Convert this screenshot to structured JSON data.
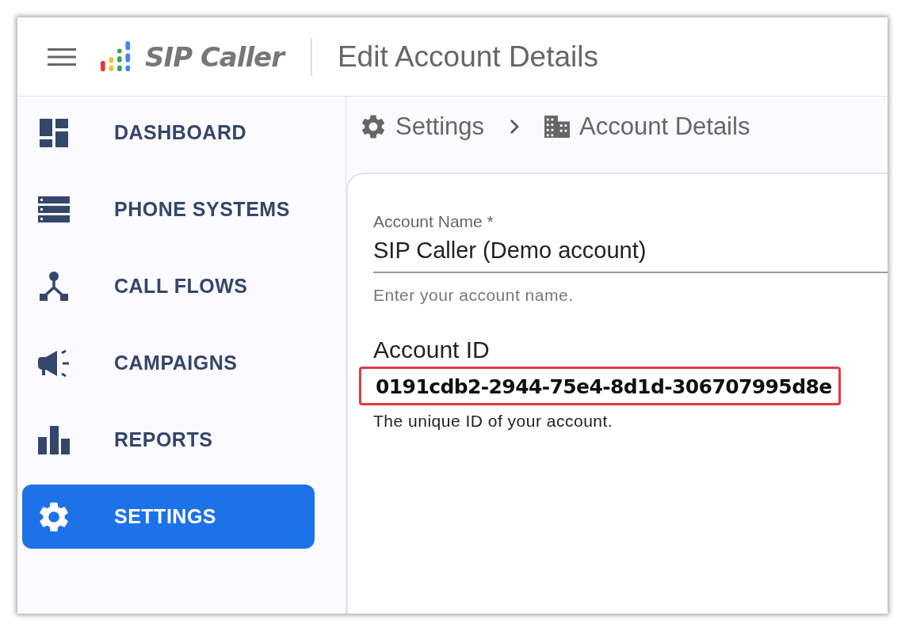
{
  "header": {
    "app_name": "SIP Caller",
    "page_title": "Edit Account Details"
  },
  "sidebar": {
    "items": [
      {
        "label": "DASHBOARD",
        "kind": "dashboard",
        "selected": false
      },
      {
        "label": "PHONE SYSTEMS",
        "kind": "systems",
        "selected": false
      },
      {
        "label": "CALL FLOWS",
        "kind": "flows",
        "selected": false
      },
      {
        "label": "CAMPAIGNS",
        "kind": "campaigns",
        "selected": false
      },
      {
        "label": "REPORTS",
        "kind": "reports",
        "selected": false
      },
      {
        "label": "SETTINGS",
        "kind": "settings",
        "selected": true
      }
    ]
  },
  "breadcrumb": [
    {
      "label": "Settings",
      "kind": "settings"
    },
    {
      "label": "Account Details",
      "kind": "building"
    }
  ],
  "form": {
    "account_name": {
      "label": "Account Name *",
      "value": "SIP Caller (Demo account)",
      "hint": "Enter your account name."
    },
    "account_id": {
      "label": "Account ID",
      "value": "0191cdb2-2944-75e4-8d1d-306707995d8e",
      "hint": "The unique ID of your account.",
      "highlighted": true
    }
  }
}
